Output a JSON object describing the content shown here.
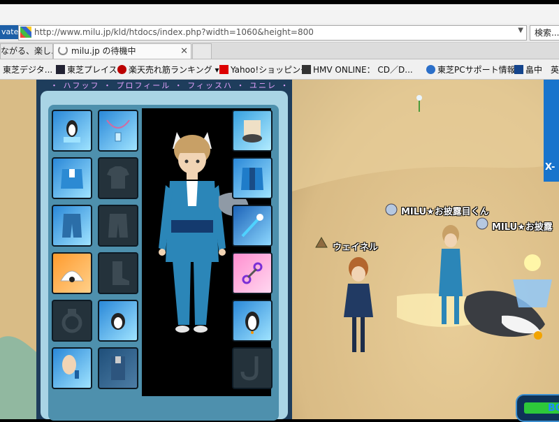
{
  "browser": {
    "inprivate_label": "vate",
    "url": "http://www.milu.jp/kld/htdocs/index.php?width=1060&height=800",
    "search_label": "検索...",
    "tabs": [
      {
        "label": "ながる、楽し..."
      },
      {
        "label": "milu.jp の待機中"
      }
    ],
    "favorites": [
      {
        "label": "東芝デジタ..."
      },
      {
        "label": "東芝プレイス"
      },
      {
        "label": "楽天売れ筋ランキング"
      },
      {
        "label": "Yahoo!ショッピング"
      },
      {
        "label": "HMV ONLINE： CD／D..."
      },
      {
        "label": "東芝PCサポート情報"
      },
      {
        "label": "畠中"
      },
      {
        "label": "英"
      }
    ]
  },
  "game": {
    "panel_title": "・ ハフッフ ・ プロフィール ・ フィッスハ ・ ユニレ ・",
    "nameplates": [
      {
        "text": "ウェイネル"
      },
      {
        "text": "MILU★お披露目くん"
      },
      {
        "text": "MILU★お披露"
      }
    ],
    "side_label": "X-",
    "bottom_button_label": "BO",
    "colors": {
      "panel_frame": "#a9d4e5",
      "panel_inner": "#4e90ad",
      "slot_filled": "#2a88d8",
      "slot_empty": "#24323b",
      "sand": "#e3c891",
      "accent_blue": "#1874cc"
    }
  }
}
